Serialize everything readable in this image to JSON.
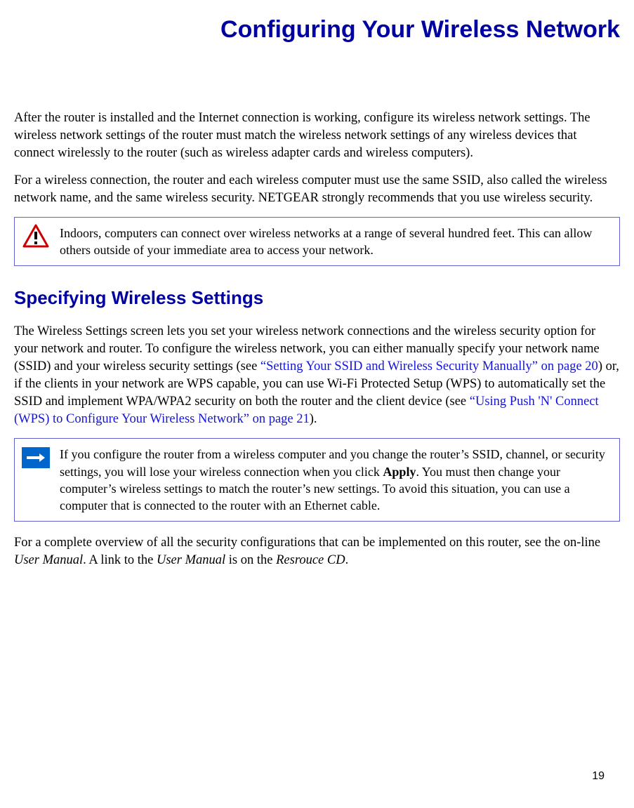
{
  "title": "Configuring Your Wireless Network",
  "paragraphs": {
    "intro1": "After the router is installed and the Internet connection is working, configure its wireless network settings. The wireless network settings of the router must match the wireless network settings of any wireless devices that connect wirelessly to the router (such as wireless adapter cards and wireless computers).",
    "intro2_a": "For a wireless connection, the router and each wireless computer must use the same SSID, also called the wireless network name, and the same wireless security. ",
    "intro2_b": "NETGEAR strongly recommends that you use wireless security."
  },
  "warning": {
    "text": "Indoors, computers can connect over wireless networks at a range of several hundred feet. This can allow others outside of your immediate area to access your network."
  },
  "section": {
    "title": "Specifying Wireless Settings",
    "p1_a": "The Wireless Settings screen lets you set your wireless network connections and the wireless security option for your network and router. To configure the wireless network, you can either manually specify your network name (SSID) and your wireless security settings (see ",
    "p1_link1": "“Setting Your SSID and Wireless Security Manually” on page 20",
    "p1_b": ") or, if the clients in your network are WPS capable, you can use Wi-Fi Protected Setup (WPS) to automatically set the SSID and implement WPA/WPA2 security on both the router and the client device (see ",
    "p1_link2": "“Using Push 'N' Connect (WPS) to Configure Your Wireless Network” on page 21",
    "p1_c": ")."
  },
  "note": {
    "part1": "If you configure the router from a wireless computer and you change the router’s SSID, channel, or security settings, you will lose your wireless connection when you click ",
    "bold": "Apply",
    "part2": ". You must then change your computer’s wireless settings to match the router’s new settings. To avoid this situation, you can use a computer that is connected to the router with an Ethernet cable."
  },
  "closing": {
    "a": "For a complete overview of all the security configurations that can be implemented on this router, see the on-line ",
    "i1": "User Manual",
    "b": ". A link to the ",
    "i2": "User Manual",
    "c": " is on the ",
    "i3": "Resrouce CD",
    "d": "."
  },
  "page_number": "19"
}
